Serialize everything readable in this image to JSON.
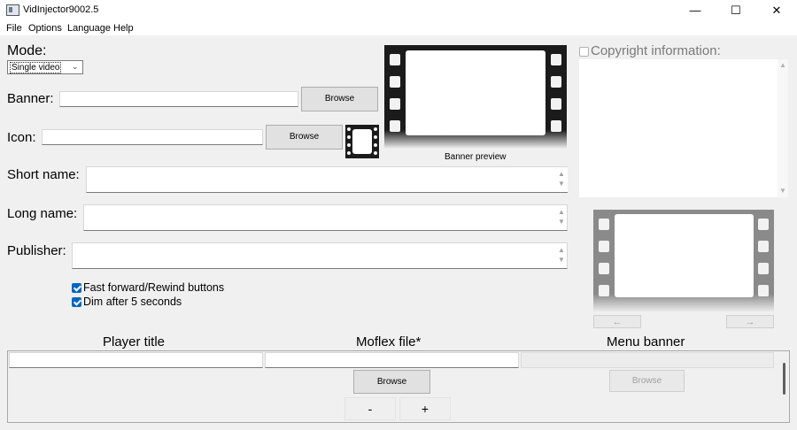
{
  "window": {
    "title": "VidInjector9002.5",
    "minimize": "—",
    "maximize": "☐",
    "close": "✕"
  },
  "menu": {
    "items": [
      "File",
      "Options",
      "Language",
      "Help"
    ]
  },
  "mode": {
    "label": "Mode:",
    "selected": "Single video"
  },
  "banner": {
    "label": "Banner:",
    "browse": "Browse",
    "preview_label": "Banner preview"
  },
  "icon": {
    "label": "Icon:",
    "browse": "Browse"
  },
  "short_name": {
    "label": "Short name:"
  },
  "long_name": {
    "label": "Long name:"
  },
  "publisher": {
    "label": "Publisher:"
  },
  "options": {
    "ffrw": {
      "label": "Fast forward/Rewind buttons",
      "checked": true
    },
    "dim": {
      "label": "Dim after 5 seconds",
      "checked": true
    }
  },
  "copyright": {
    "label": "Copyright information:",
    "checked": false
  },
  "nav": {
    "prev": "←",
    "next": "→"
  },
  "table": {
    "headers": [
      "Player title",
      "Moflex file*",
      "Menu banner"
    ],
    "browse_moflex": "Browse",
    "browse_banner": "Browse",
    "remove": "-",
    "add": "+"
  },
  "colors": {
    "accent": "#0067c0",
    "film": "#1b1b1b",
    "film_gray": "#8a8a8a"
  }
}
